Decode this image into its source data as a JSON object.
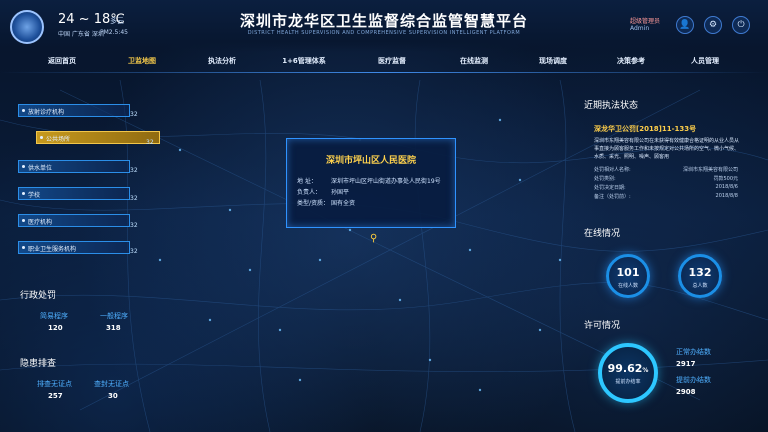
{
  "header": {
    "temperature": "24 ~ 18℃",
    "condition": "多云",
    "location": "中国 广东省 深圳",
    "pm": "PM2.5:45",
    "title": "深圳市龙华区卫生监督综合监管智慧平台",
    "subtitle": "DISTRICT HEALTH SUPERVISION AND COMPREHENSIVE SUPERVISION INTELLIGENT PLATFORM",
    "user_role": "超级管理员",
    "user_name": "Admin"
  },
  "nav": {
    "items": [
      "返回首页",
      "卫监地图",
      "执法分析",
      "1+6管理体系",
      "医疗监督",
      "在线监测",
      "现场调度",
      "决策参考",
      "人员管理"
    ],
    "active_index": 1
  },
  "categories": [
    {
      "label": "放射诊疗机构",
      "count": "32"
    },
    {
      "label": "公共场所",
      "count": "32"
    },
    {
      "label": "供水单位",
      "count": "32"
    },
    {
      "label": "学校",
      "count": "32"
    },
    {
      "label": "医疗机构",
      "count": "32"
    },
    {
      "label": "职业卫生服务机构",
      "count": "32"
    }
  ],
  "admin_penalty": {
    "title": "行政处罚",
    "simple_label": "简易程序",
    "simple_value": "120",
    "general_label": "一般程序",
    "general_value": "318"
  },
  "hazard": {
    "title": "隐患排查",
    "untreated_label": "排查无证点",
    "untreated_value": "257",
    "treated_label": "查封无证点",
    "treated_value": "30"
  },
  "popup": {
    "title": "深圳市坪山区人民医院",
    "rows": [
      {
        "k": "地 址：",
        "v": "深圳市坪山区坪山街道办事处人民街19号"
      },
      {
        "k": "负责人：",
        "v": "孙国平"
      },
      {
        "k": "类型/资质：",
        "v": "国有全资"
      }
    ]
  },
  "enforcement": {
    "title": "近期执法状态",
    "case_no": "深龙华卫公罚[2018]11-133号",
    "desc": "深圳市东翔美容有限公司在未获得有效健康合格证明的从业人员从事直接为顾客服务工作和未按规定对公共场所的空气、微小气候、水质、采光、照明、噪声、顾客用",
    "kv": [
      {
        "k": "处罚相对人名称:",
        "v": "深圳市东翔美容有限公司"
      },
      {
        "k": "处罚类别:",
        "v": "罚款500元"
      },
      {
        "k": "处罚决定日期:",
        "v": "2018/8/6"
      },
      {
        "k": "备注（处罚前）:",
        "v": "2018/8/8"
      }
    ]
  },
  "online": {
    "title": "在线情况",
    "online_value": "101",
    "online_label": "在线人数",
    "total_value": "132",
    "total_label": "总人数"
  },
  "license": {
    "title": "许可情况",
    "rate": "99.62",
    "rate_unit": "%",
    "rate_label": "提前办结率",
    "normal_label": "正常办结数",
    "normal_value": "2917",
    "early_label": "提前办结数",
    "early_value": "2908"
  }
}
